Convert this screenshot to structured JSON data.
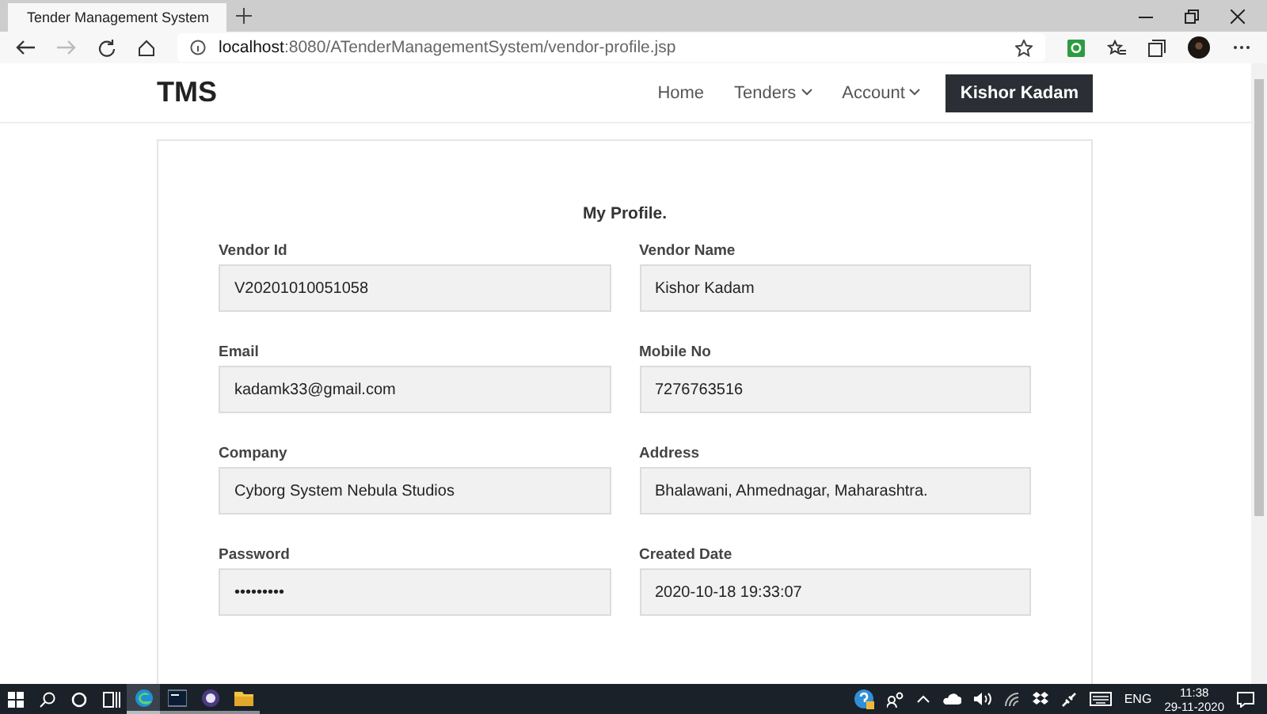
{
  "browser": {
    "tab_title": "Tender Management System",
    "address": {
      "host": "localhost",
      "rest": ":8080/ATenderManagementSystem/vendor-profile.jsp"
    }
  },
  "navbar": {
    "brand": "TMS",
    "links": [
      {
        "label": "Home",
        "kind": "link"
      },
      {
        "label": "Tenders",
        "kind": "dropdown"
      },
      {
        "label": "Account",
        "kind": "dropdown"
      }
    ],
    "user_button": "Kishor Kadam"
  },
  "profile": {
    "title": "My Profile.",
    "fields": [
      {
        "label": "Vendor Id",
        "value": "V20201010051058"
      },
      {
        "label": "Vendor Name",
        "value": "Kishor Kadam"
      },
      {
        "label": "Email",
        "value": "kadamk33@gmail.com"
      },
      {
        "label": "Mobile No",
        "value": "7276763516"
      },
      {
        "label": "Company",
        "value": "Cyborg System Nebula Studios"
      },
      {
        "label": "Address",
        "value": "Bhalawani, Ahmednagar, Maharashtra."
      },
      {
        "label": "Password",
        "value": "•••••••••"
      },
      {
        "label": "Created Date",
        "value": "2020-10-18 19:33:07"
      }
    ]
  },
  "taskbar": {
    "apps": [
      {
        "kind": "edge",
        "selected": true
      },
      {
        "kind": "terminal",
        "selected": false
      },
      {
        "kind": "eclipse",
        "selected": false
      },
      {
        "kind": "folder",
        "selected": false
      }
    ],
    "language": "ENG",
    "time": "11:38",
    "date": "29-11-2020"
  }
}
